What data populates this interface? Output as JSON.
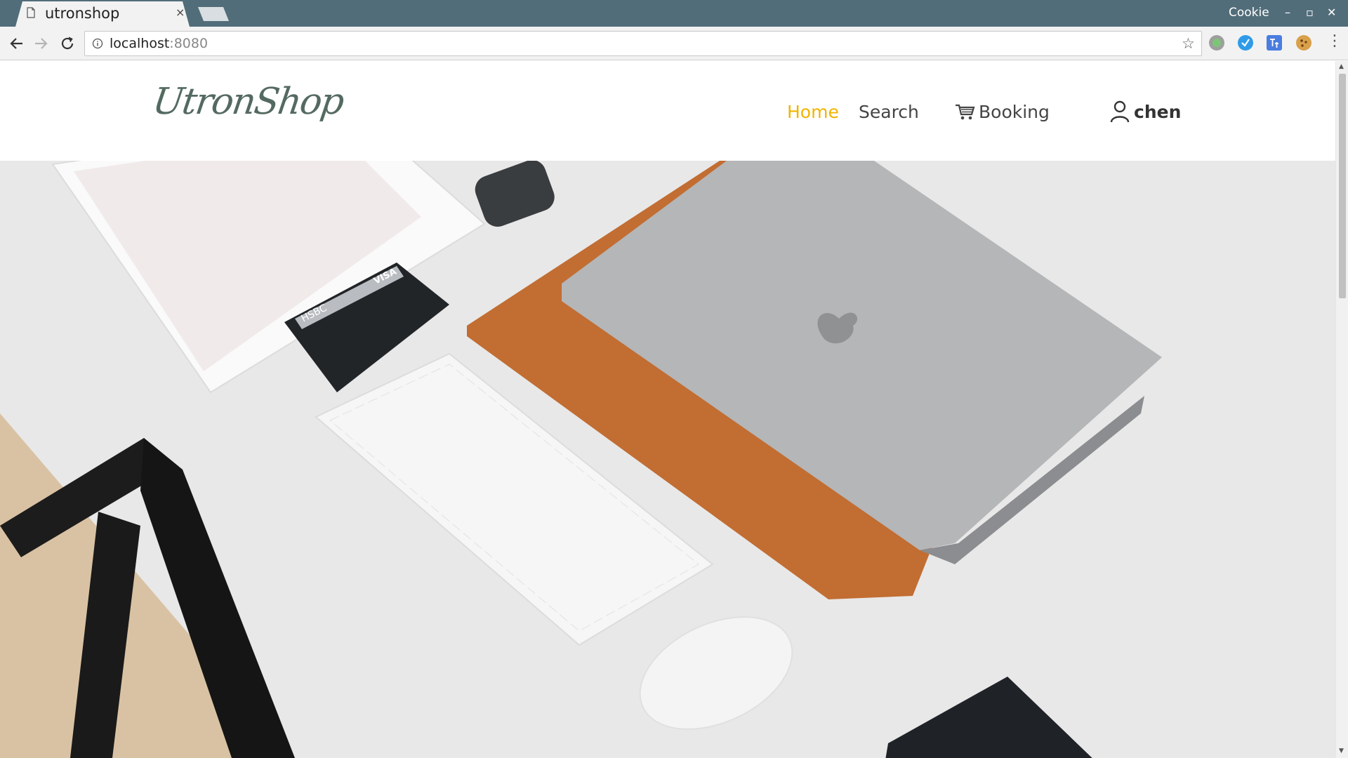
{
  "browser": {
    "tab_title": "utronshop",
    "tab_close": "×",
    "profile_label": "Cookie",
    "window_minimize": "–",
    "window_maximize": "▫",
    "window_close": "✕",
    "address_host": "localhost",
    "address_port": ":8080",
    "bookmark_star": "☆",
    "menu": "⋮"
  },
  "site": {
    "logo": "UtronShop",
    "nav": {
      "home": "Home",
      "search": "Search",
      "booking": "Booking",
      "user": "chen"
    },
    "colors": {
      "active_nav": "#f0b400",
      "logo": "#546a60",
      "browser_frame": "#526d7a"
    }
  },
  "hero": {
    "card_brand": "HSBC",
    "card_network": "VISA"
  }
}
